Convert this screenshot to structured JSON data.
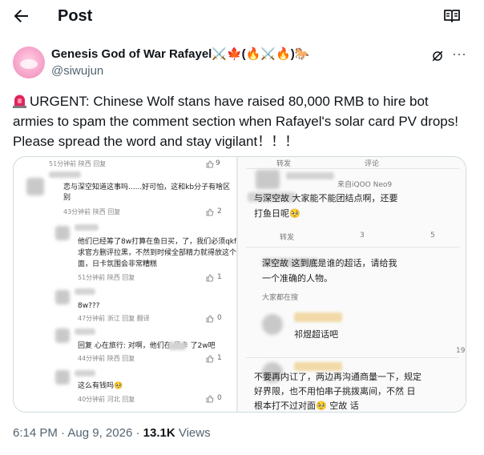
{
  "header": {
    "title": "Post",
    "back_icon": "arrow-left-icon",
    "reader_icon": "book-open-icon"
  },
  "author": {
    "display_name": "Genesis God of War Rafayel⚔️🍁(🔥⚔️🔥)🐎",
    "handle": "@siwujun"
  },
  "post": {
    "text": "URGENT: Chinese Wolf stans have raised 80,000 RMB to hire bot armies to spam the comment section when Rafayel's solar card PV drops! Please spread the word and stay vigilant！！！",
    "time": "6:14 PM",
    "date": "Aug 9, 2026",
    "views_count": "13.1K",
    "views_label": "Views",
    "dot": "·"
  },
  "screenshot_left": {
    "c0": {
      "meta": "51分钟前 陕西  回复",
      "likes": "9"
    },
    "c1": {
      "line1": "恋与深空知道这事吗......好可怕，这和kb分子有啥区",
      "line2": "别",
      "meta": "43分钟前 陕西  回复",
      "likes": "2"
    },
    "c2": {
      "line1": "他们已经筹了8w打算在鱼日买，了，我们必须qkf要",
      "line2": "求官方删评拉黑，不然到时候全部精力就得放这个上",
      "line3": "面，日卡氛围会非常糟糕",
      "meta": "51分钟前 陕西  回复",
      "likes": "1"
    },
    "c3": {
      "line1": "8w???",
      "meta": "47分钟前 浙江  回复  翻译",
      "likes": "0"
    },
    "c4": {
      "line1": "回复 心在旅行: 对啊，他们在        月卡    了2w吧",
      "meta": "44分钟前 陕西  回复",
      "likes": "1"
    },
    "c5": {
      "line1": "这么有钱吗🥺",
      "meta": "40分钟前 河北  回复",
      "likes": "0"
    }
  },
  "screenshot_right": {
    "top_actions": {
      "repost": "转发",
      "comment": "评论"
    },
    "r0": {
      "meta": "来自iQOO Neo9"
    },
    "r1": {
      "line1": "与深空故    大家能不能团结点啊，还要",
      "line2": "打鱼日呢🥺",
      "repost": "转发",
      "comments": "3",
      "likes": "5"
    },
    "r2": {
      "line1": "深空故    这到底是谁的超话，请给我",
      "line2": "一个准确的人物。",
      "meta": "大家都在搜"
    },
    "r3": {
      "line1": "祁煜超话吧"
    },
    "r4": {
      "likes": "19"
    },
    "r5": {
      "line1": "不要再内讧了，两边再沟通商量一下，规定",
      "line2": "好界限，也不用怕串子挑拨离间，不然   日",
      "line3": "根本打不过对面🥺     空故    话"
    }
  }
}
